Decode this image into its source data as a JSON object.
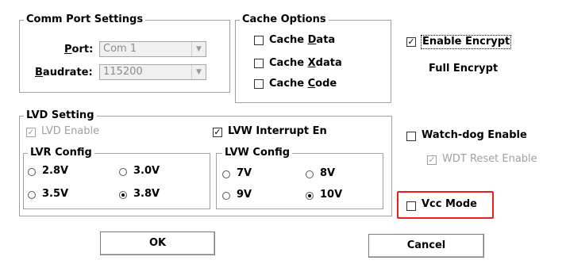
{
  "comm": {
    "title": "Comm Port Settings",
    "port_label_u": "P",
    "port_label_rest": "ort:",
    "baud_label_u": "B",
    "baud_label_rest": "audrate:",
    "port_value": "Com 1",
    "baud_value": "115200"
  },
  "cache": {
    "title": "Cache Options",
    "data_pre": "Cache ",
    "data_u": "D",
    "data_rest": "ata",
    "xdata_pre": "Cache ",
    "xdata_u": "X",
    "xdata_rest": "data",
    "code_pre": "Cache ",
    "code_u": "C",
    "code_rest": "ode"
  },
  "encrypt": {
    "label": "Enable Encrypt",
    "sub": "Full Encrypt"
  },
  "lvd": {
    "title": "LVD Setting",
    "lvd_enable": "LVD Enable",
    "lvw_interrupt": "LVW Interrupt En",
    "lvr": {
      "title": "LVR Config",
      "opt1": "2.8V",
      "opt2": "3.0V",
      "opt3": "3.5V",
      "opt4": "3.8V"
    },
    "lvw": {
      "title": "LVW Config",
      "opt1": "7V",
      "opt2": "8V",
      "opt3": "9V",
      "opt4": "10V"
    }
  },
  "watchdog": {
    "label": "Watch-dog Enable",
    "wdt_reset": "WDT Reset Enable"
  },
  "vcc": {
    "label": "Vcc Mode"
  },
  "buttons": {
    "ok": "OK",
    "cancel": "Cancel"
  },
  "checks": {
    "mark": "✓"
  },
  "combo": {
    "arrow": "▼"
  },
  "colors": {
    "highlight": "#e8221a",
    "group_border": "#a0a0a0",
    "disabled": "#a0a0a0"
  }
}
